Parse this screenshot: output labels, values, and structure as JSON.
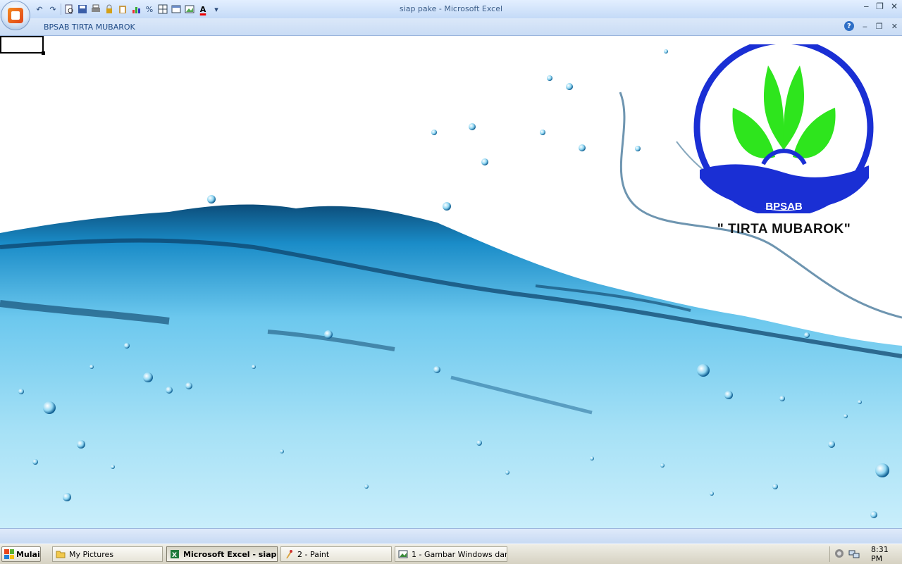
{
  "window": {
    "title": "siap pake - Microsoft Excel",
    "controls": [
      "minimize",
      "restore",
      "close"
    ]
  },
  "quick_access": {
    "icons": [
      "undo-icon",
      "redo-icon",
      "print-preview-icon",
      "save-icon",
      "print-icon",
      "permission-icon",
      "paste-special-icon",
      "chart-icon",
      "percent-icon",
      "border-icon",
      "table-icon",
      "picture-icon",
      "font-color-icon",
      "customize-icon"
    ],
    "percent_label": "%",
    "font_color_label": "A"
  },
  "workbook": {
    "title": "BPSAB TIRTA MUBAROK",
    "help_label": "?"
  },
  "sheet": {
    "logo": {
      "text_bpsab": "BPSAB",
      "text_name": "\" TIRTA MUBAROK\"",
      "colors": {
        "ring": "#1a2fd4",
        "leaves": "#2ee51d",
        "text": "#111111"
      }
    },
    "background_image": "water-splash"
  },
  "taskbar": {
    "start_label": "Mulai",
    "items": [
      {
        "label": "My Pictures",
        "icon": "folder-icon",
        "active": false
      },
      {
        "label": "Microsoft Excel - siap ...",
        "icon": "excel-icon",
        "active": true
      },
      {
        "label": "2 - Paint",
        "icon": "paint-icon",
        "active": false
      },
      {
        "label": "1 - Gambar Windows dan...",
        "icon": "image-icon",
        "active": false
      }
    ],
    "clock": "8:31 PM"
  }
}
